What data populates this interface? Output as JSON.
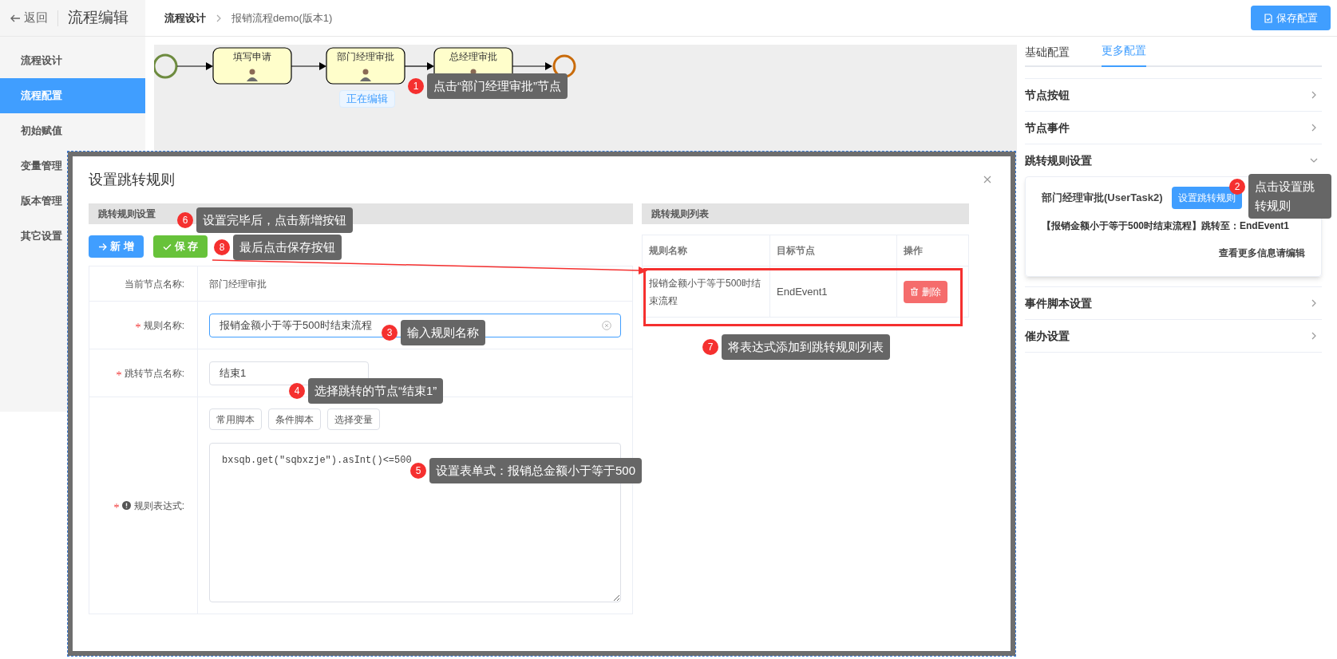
{
  "header": {
    "back": "返回",
    "title": "流程编辑"
  },
  "breadcrumb": [
    "流程设计",
    "报销流程demo(版本1)"
  ],
  "save_button": "保存配置",
  "sidebar": {
    "items": [
      {
        "label": "流程设计",
        "selected": false
      },
      {
        "label": "流程配置",
        "selected": true
      },
      {
        "label": "初始赋值",
        "selected": false
      },
      {
        "label": "变量管理",
        "selected": false
      },
      {
        "label": "版本管理",
        "selected": false
      },
      {
        "label": "其它设置",
        "selected": false
      }
    ]
  },
  "diagram": {
    "tasks": [
      "填写申请",
      "部门经理审批",
      "总经理审批"
    ],
    "editing_badge": "正在编辑"
  },
  "panel": {
    "tabs": [
      {
        "label": "基础配置",
        "selected": false
      },
      {
        "label": "更多配置",
        "selected": true
      }
    ],
    "sections": [
      {
        "title": "节点按钮",
        "expanded": false
      },
      {
        "title": "节点事件",
        "expanded": false
      },
      {
        "title": "跳转规则设置",
        "expanded": true,
        "card": {
          "node": "部门经理审批(UserTask2)",
          "button": "设置跳转规则",
          "rule": "【报销金额小于等于500时结束流程】跳转至：EndEvent1",
          "more": "查看更多信息请编辑"
        }
      },
      {
        "title": "事件脚本设置",
        "expanded": false
      },
      {
        "title": "催办设置",
        "expanded": false
      }
    ]
  },
  "dialog": {
    "title": "设置跳转规则",
    "left_header": "跳转规则设置",
    "buttons": [
      {
        "label": "新 增",
        "kind": "add"
      },
      {
        "label": "保 存",
        "kind": "save"
      }
    ],
    "form": [
      {
        "label": "当前节点名称:",
        "kind": "text",
        "value": "部门经理审批"
      },
      {
        "label": "规则名称:",
        "required": true,
        "kind": "input",
        "value": "报销金额小于等于500时结束流程"
      },
      {
        "label": "跳转节点名称:",
        "required": true,
        "kind": "select",
        "value": "结束1"
      },
      {
        "label": "规则表达式:",
        "required": true,
        "kind": "script",
        "tools": [
          "常用脚本",
          "条件脚本",
          "选择变量"
        ],
        "value": "bxsqb.get(\"sqbxzje\").asInt()<=500"
      }
    ],
    "right_header": "跳转规则列表",
    "columns": [
      "规则名称",
      "目标节点",
      "操作"
    ],
    "rows": [
      {
        "name": "报销金额小于等于500时结束流程",
        "target": "EndEvent1",
        "action": "删除"
      }
    ]
  },
  "annotations": [
    {
      "number": "1",
      "text": "点击“部门经理审批”节点"
    },
    {
      "number": "2",
      "text": "点击设置跳转规则"
    },
    {
      "number": "3",
      "text": "输入规则名称"
    },
    {
      "number": "4",
      "text": "选择跳转的节点“结束1”"
    },
    {
      "number": "5",
      "text": "设置表单式：报销总金额小于等于500"
    },
    {
      "number": "6",
      "text": "设置完毕后，点击新增按钮"
    },
    {
      "number": "7",
      "text": "将表达式添加到跳转规则列表"
    },
    {
      "number": "8",
      "text": "最后点击保存按钮"
    }
  ]
}
